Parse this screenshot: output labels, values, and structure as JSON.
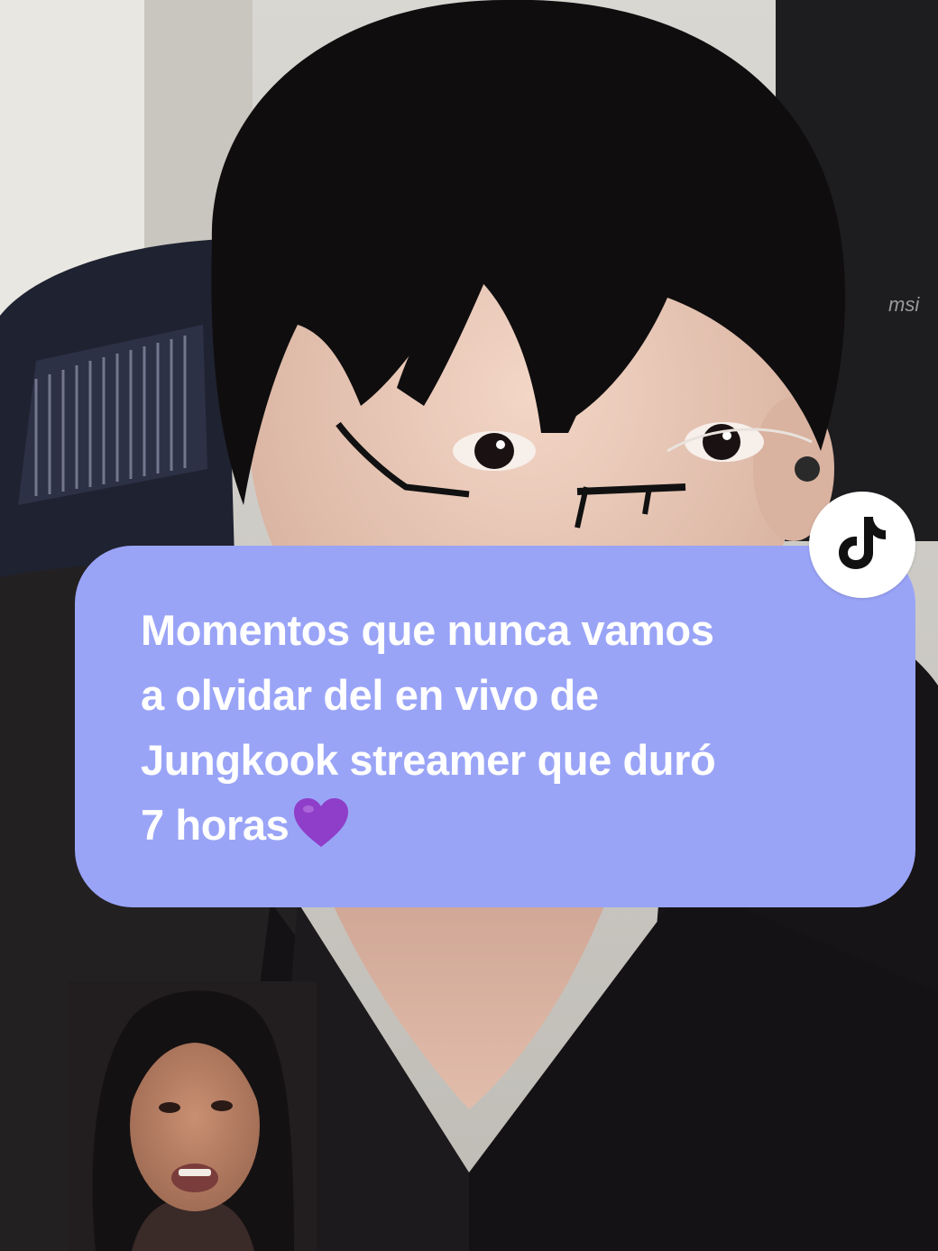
{
  "caption": {
    "lines": [
      "Momentos que nunca vamos",
      "a olvidar del en vivo de",
      "Jungkook streamer que duró",
      "7 horas"
    ],
    "emoji": "purple-heart",
    "background_color": "#9aa4f7",
    "text_color": "#ffffff"
  },
  "badge": {
    "icon": "tiktok-logo-icon",
    "background_color": "#ffffff"
  },
  "background": {
    "description_icon": "video-frame",
    "brand_text": "msi"
  }
}
